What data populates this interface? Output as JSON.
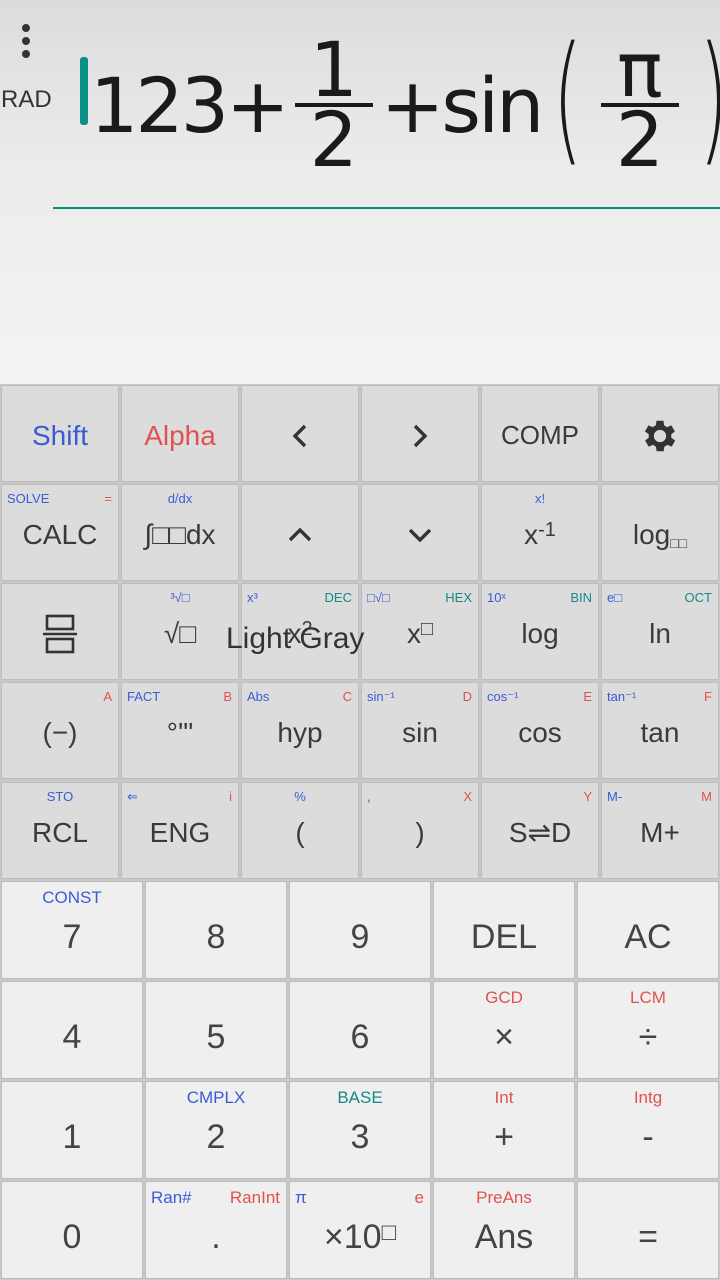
{
  "display": {
    "mode": "RAD",
    "expr_int": "123+",
    "frac1_num": "1",
    "frac1_den": "2",
    "plus": "+sin",
    "open_paren": "(",
    "frac2_num": "π",
    "frac2_den": "2",
    "close_paren": ")"
  },
  "overlay": "Light Gray",
  "row1": {
    "shift": "Shift",
    "alpha": "Alpha",
    "comp": "COMP"
  },
  "row2": {
    "calc": "CALC",
    "calc_sub_l": "SOLVE",
    "calc_sub_r": "=",
    "integ": "∫□□dx",
    "integ_sub": "d/dx",
    "xinv": "x",
    "xinv_sup": "-1",
    "xinv_sub": "x!",
    "logb": "log",
    "logb_box": "□□"
  },
  "row3": {
    "sqrt": "√□",
    "sqrt_sub": "³√□",
    "sq": "x",
    "sq_sup": "2",
    "sq_sub_l": "x³",
    "sq_sub_r": "DEC",
    "pow": "x",
    "pow_sup": "□",
    "pow_sub_l": "□√□",
    "pow_sub_r": "HEX",
    "log": "log",
    "log_sub_l": "10ˣ",
    "log_sub_r": "BIN",
    "ln": "ln",
    "ln_sub_l": "e□",
    "ln_sub_r": "OCT"
  },
  "row4": {
    "neg": "(−)",
    "neg_sub_r": "A",
    "deg": "°'\"",
    "deg_sub_l": "FACT",
    "deg_sub_r": "B",
    "hyp": "hyp",
    "hyp_sub_l": "Abs",
    "hyp_sub_r": "C",
    "sin": "sin",
    "sin_sub_l": "sin⁻¹",
    "sin_sub_r": "D",
    "cos": "cos",
    "cos_sub_l": "cos⁻¹",
    "cos_sub_r": "E",
    "tan": "tan",
    "tan_sub_l": "tan⁻¹",
    "tan_sub_r": "F"
  },
  "row5": {
    "rcl": "RCL",
    "rcl_sub": "STO",
    "eng": "ENG",
    "eng_sub_l": "⇐",
    "eng_sub_r": "i",
    "lpar": "(",
    "lpar_sub": "%",
    "rpar": ")",
    "rpar_sub_l": ",",
    "rpar_sub_r": "X",
    "sd": "S⇌D",
    "sd_sub_r": "Y",
    "mplus": "M+",
    "mplus_sub_l": "M-",
    "mplus_sub_r": "M"
  },
  "num1": {
    "k7": "7",
    "k7_sub": "CONST",
    "k8": "8",
    "k9": "9",
    "del": "DEL",
    "ac": "AC"
  },
  "num2": {
    "k4": "4",
    "k5": "5",
    "k6": "6",
    "mul": "×",
    "mul_sub": "GCD",
    "div": "÷",
    "div_sub": "LCM"
  },
  "num3": {
    "k1": "1",
    "k2": "2",
    "k2_sub": "CMPLX",
    "k3": "3",
    "k3_sub": "BASE",
    "plus": "+",
    "plus_sub": "Int",
    "minus": "-",
    "minus_sub": "Intg"
  },
  "num4": {
    "k0": "0",
    "dot": ".",
    "dot_sub_l": "Ran#",
    "dot_sub_r": "RanInt",
    "exp": "×10",
    "exp_sup": "□",
    "exp_sub_l": "π",
    "exp_sub_r": "e",
    "ans": "Ans",
    "ans_sub": "PreAns",
    "eq": "="
  },
  "colors": {
    "accent": "#0a8f84",
    "blue": "#3a5bd6",
    "red": "#e0524f",
    "orange": "#c98610"
  }
}
